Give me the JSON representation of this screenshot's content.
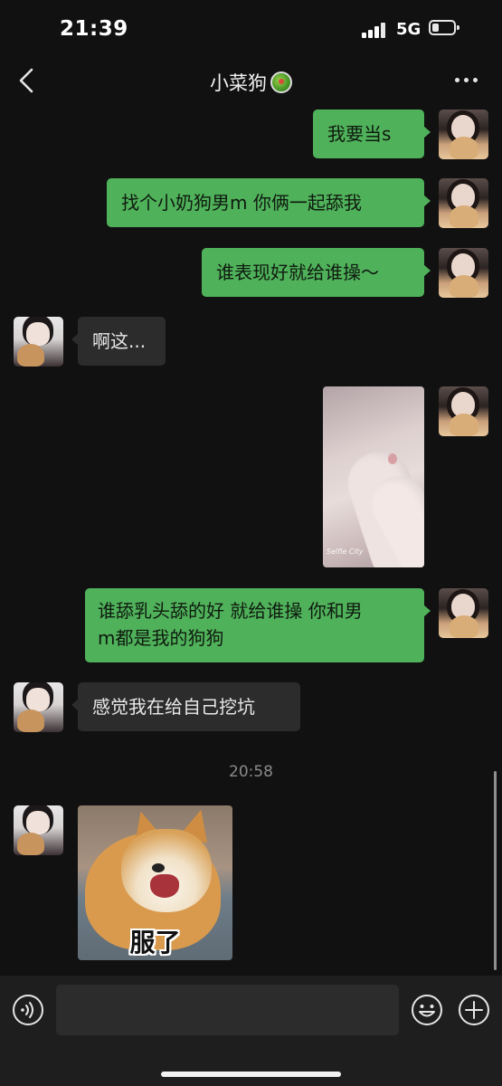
{
  "status": {
    "time": "21:39",
    "network": "5G",
    "battery_level": 0.25
  },
  "header": {
    "title": "小菜狗"
  },
  "messages": [
    {
      "side": "sent",
      "text": "我要当s"
    },
    {
      "side": "sent",
      "text": "找个小奶狗男m 你俩一起舔我"
    },
    {
      "side": "sent",
      "text": "谁表现好就给谁操～"
    },
    {
      "side": "received",
      "text": "啊这..."
    },
    {
      "side": "sent",
      "type": "image",
      "watermark": "Selfie City"
    },
    {
      "side": "sent",
      "text_line1": "谁舔乳头舔的好 就给谁操 你和男",
      "text_line2": "m都是我的狗狗"
    },
    {
      "side": "received",
      "text": "感觉我在给自己挖坑"
    },
    {
      "type": "timestamp",
      "text": "20:58"
    },
    {
      "side": "received",
      "type": "sticker",
      "caption": "服了"
    }
  ],
  "input": {
    "placeholder": ""
  },
  "icons": [
    "back-icon",
    "more-icon",
    "voice-icon",
    "emoji-icon",
    "plus-icon"
  ],
  "colors": {
    "sent_bubble": "#4fb15a",
    "received_bubble": "#2c2c2c",
    "background": "#111111"
  }
}
